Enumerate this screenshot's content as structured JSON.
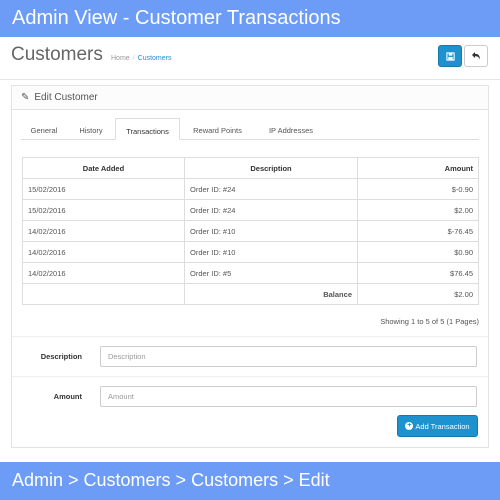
{
  "banner_top": "Admin View - Customer Transactions",
  "banner_bottom": "Admin > Customers > Customers > Edit",
  "header": {
    "title": "Customers",
    "breadcrumb": [
      "Home",
      "Customers"
    ],
    "save_icon": "save-icon",
    "back_icon": "back-icon"
  },
  "panel": {
    "heading": "Edit Customer",
    "heading_icon": "pencil-icon"
  },
  "tabs": [
    "General",
    "History",
    "Transactions",
    "Reward Points",
    "IP Addresses"
  ],
  "active_tab": "Transactions",
  "table": {
    "headers": [
      "Date Added",
      "Description",
      "Amount"
    ],
    "rows": [
      [
        "15/02/2016",
        "Order ID: #24",
        "$-0.90"
      ],
      [
        "15/02/2016",
        "Order ID: #24",
        "$2.00"
      ],
      [
        "14/02/2016",
        "Order ID: #10",
        "$-76.45"
      ],
      [
        "14/02/2016",
        "Order ID: #10",
        "$0.90"
      ],
      [
        "14/02/2016",
        "Order ID: #5",
        "$76.45"
      ]
    ],
    "balance_label": "Balance",
    "balance_value": "$2.00"
  },
  "pagination_text": "Showing 1 to 5 of 5 (1 Pages)",
  "form": {
    "description_label": "Description",
    "description_placeholder": "Description",
    "description_value": "",
    "amount_label": "Amount",
    "amount_placeholder": "Amount",
    "amount_value": ""
  },
  "add_button_label": "Add Transaction",
  "colors": {
    "banner": "#6c9cf5",
    "primary": "#1e91cf"
  }
}
